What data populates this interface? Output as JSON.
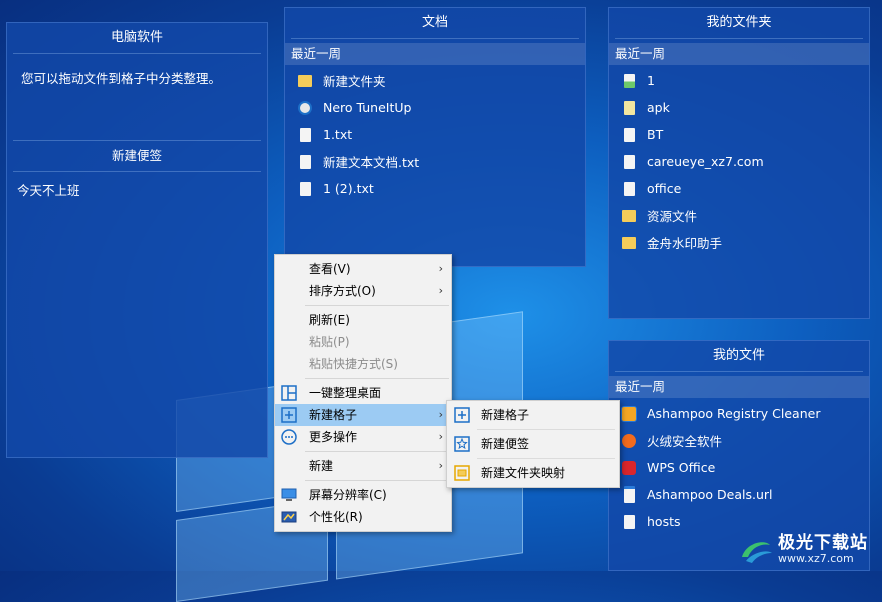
{
  "panels": {
    "pc_software": {
      "title": "电脑软件",
      "hint": "您可以拖动文件到格子中分类整理。",
      "note_title": "新建便签",
      "note_text": "今天不上班"
    },
    "documents": {
      "title": "文档",
      "section": "最近一周",
      "items": [
        {
          "label": "新建文件夹",
          "icon": "folder-icon"
        },
        {
          "label": "Nero TuneItUp",
          "icon": "app-icon"
        },
        {
          "label": "1.txt",
          "icon": "text-file-icon"
        },
        {
          "label": "新建文本文档.txt",
          "icon": "text-file-icon"
        },
        {
          "label": "1 (2).txt",
          "icon": "text-file-icon"
        }
      ]
    },
    "my_folders": {
      "title": "我的文件夹",
      "section": "最近一周",
      "items": [
        {
          "label": "1",
          "icon": "image-file-icon"
        },
        {
          "label": "apk",
          "icon": "archive-file-icon"
        },
        {
          "label": "BT",
          "icon": "file-icon"
        },
        {
          "label": "careueye_xz7.com",
          "icon": "file-icon"
        },
        {
          "label": "office",
          "icon": "file-icon"
        },
        {
          "label": "资源文件",
          "icon": "folder-icon"
        },
        {
          "label": "金舟水印助手",
          "icon": "folder-icon"
        }
      ]
    },
    "my_files": {
      "title": "我的文件",
      "section": "最近一周",
      "items": [
        {
          "label": "Ashampoo Registry Cleaner",
          "icon": "ashampoo-icon"
        },
        {
          "label": "火绒安全软件",
          "icon": "huorong-icon"
        },
        {
          "label": "WPS Office",
          "icon": "wps-icon"
        },
        {
          "label": "Ashampoo Deals.url",
          "icon": "url-file-icon"
        },
        {
          "label": "hosts",
          "icon": "file-icon"
        }
      ]
    }
  },
  "context_menu": {
    "items": [
      {
        "label": "查看(V)",
        "submenu": true
      },
      {
        "label": "排序方式(O)",
        "submenu": true
      },
      {
        "label": "刷新(E)"
      },
      {
        "label": "粘贴(P)",
        "disabled": true
      },
      {
        "label": "粘贴快捷方式(S)",
        "disabled": true
      },
      {
        "label": "一键整理桌面",
        "icon": "organize-desktop-icon"
      },
      {
        "label": "新建格子",
        "submenu": true,
        "highlighted": true,
        "icon": "new-grid-icon"
      },
      {
        "label": "更多操作",
        "submenu": true,
        "icon": "more-icon"
      },
      {
        "label": "新建",
        "submenu": true
      },
      {
        "label": "屏幕分辨率(C)",
        "icon": "monitor-icon"
      },
      {
        "label": "个性化(R)",
        "icon": "personalize-icon"
      }
    ]
  },
  "submenu": {
    "items": [
      {
        "label": "新建格子",
        "icon": "new-grid-icon"
      },
      {
        "label": "新建便签",
        "icon": "new-note-icon"
      },
      {
        "label": "新建文件夹映射",
        "icon": "folder-map-icon"
      }
    ]
  },
  "watermark": {
    "name": "极光下载站",
    "url": "www.xz7.com"
  },
  "colors": {
    "accent_highlight": "#9ccbf3",
    "panel_bg": "#1248a8",
    "folder_yellow": "#f4cc5a"
  }
}
